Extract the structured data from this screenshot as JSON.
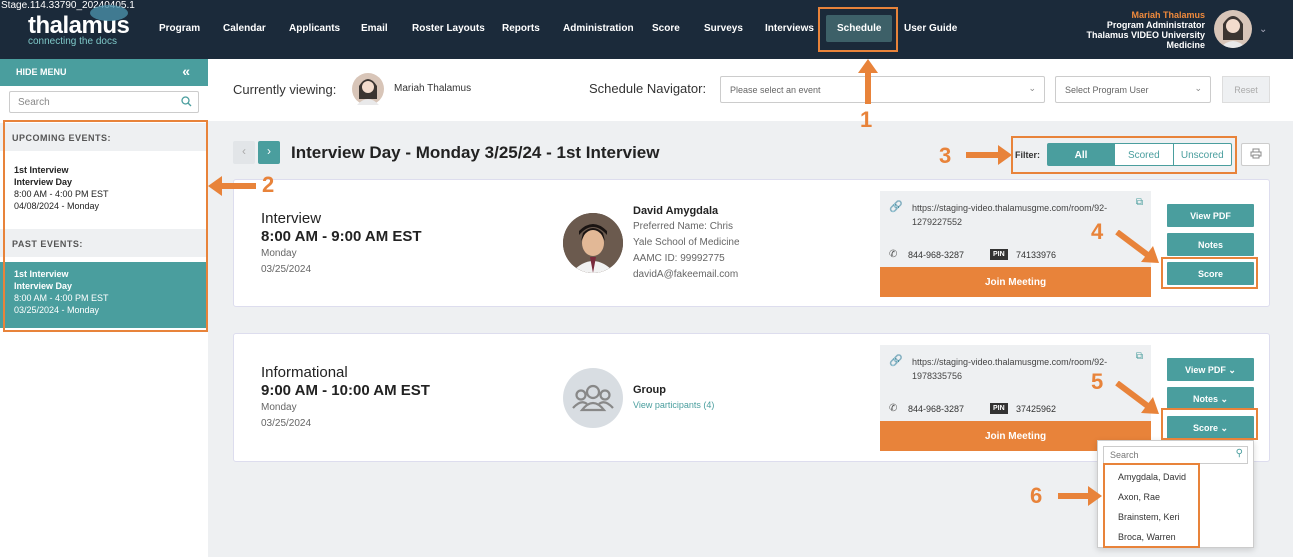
{
  "stage_label": "Stage.114.33790_20240405.1",
  "logo": {
    "brand": "thalamus",
    "tagline": "connecting the docs"
  },
  "nav": {
    "items": [
      "Program",
      "Calendar",
      "Applicants",
      "Email",
      "Roster Layouts",
      "Reports",
      "Administration",
      "Score",
      "Surveys",
      "Interviews",
      "Schedule",
      "User Guide"
    ],
    "active": "Schedule"
  },
  "user": {
    "name": "Mariah Thalamus",
    "role": "Program Administrator",
    "org_line1": "Thalamus VIDEO University",
    "org_line2": "Medicine"
  },
  "sidebar": {
    "hide_label": "HIDE MENU",
    "search_placeholder": "Search",
    "upcoming_label": "UPCOMING EVENTS:",
    "past_label": "PAST EVENTS:",
    "upcoming": [
      {
        "l1": "1st Interview",
        "l2": "Interview Day",
        "l3": "8:00 AM - 4:00 PM EST",
        "l4": "04/08/2024 - Monday"
      }
    ],
    "past": [
      {
        "l1": "1st Interview",
        "l2": "Interview Day",
        "l3": "8:00 AM - 4:00 PM EST",
        "l4": "03/25/2024 - Monday"
      }
    ]
  },
  "header": {
    "currently_viewing": "Currently viewing:",
    "viewing_name": "Mariah Thalamus",
    "navigator_label": "Schedule Navigator:",
    "event_placeholder": "Please select an event",
    "user_placeholder": "Select Program User",
    "reset": "Reset"
  },
  "day": {
    "title": "Interview Day - Monday 3/25/24 - 1st Interview",
    "filter_label": "Filter:",
    "filters": [
      "All",
      "Scored",
      "Unscored"
    ],
    "active_filter": "All"
  },
  "cards": [
    {
      "type": "Interview",
      "time": "8:00 AM - 9:00 AM EST",
      "weekday": "Monday",
      "date": "03/25/2024",
      "person": {
        "name": "David Amygdala",
        "preferred": "Preferred Name: Chris",
        "school": "Yale School of Medicine",
        "aamc": "AAMC ID: 99992775",
        "email": "davidA@fakeemail.com"
      },
      "meeting": {
        "url": "https://staging-video.thalamusgme.com/room/92-1279227552",
        "phone": "844-968-3287",
        "pin_label": "PIN",
        "pin": "74133976",
        "join": "Join Meeting"
      },
      "actions": [
        "View PDF",
        "Notes",
        "Score"
      ]
    },
    {
      "type": "Informational",
      "time": "9:00 AM - 10:00 AM EST",
      "weekday": "Monday",
      "date": "03/25/2024",
      "group": {
        "name": "Group",
        "link": "View participants (4)"
      },
      "meeting": {
        "url": "https://staging-video.thalamusgme.com/room/92-1978335756",
        "phone": "844-968-3287",
        "pin_label": "PIN",
        "pin": "37425962",
        "join": "Join Meeting"
      },
      "actions": [
        "View PDF",
        "Notes",
        "Score"
      ]
    }
  ],
  "score_dropdown": {
    "search_placeholder": "Search",
    "items": [
      "Amygdala, David",
      "Axon, Rae",
      "Brainstem, Keri",
      "Broca, Warren"
    ]
  },
  "annotations": [
    "1",
    "2",
    "3",
    "4",
    "5",
    "6"
  ],
  "colors": {
    "nav_bg": "#1b2a3a",
    "teal": "#4a9e9e",
    "orange": "#e8833a",
    "accent_name": "#f08a3c"
  }
}
